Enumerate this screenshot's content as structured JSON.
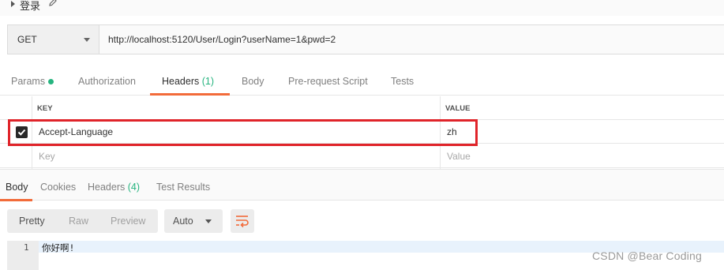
{
  "request": {
    "name": "登录",
    "method": "GET",
    "url": "http://localhost:5120/User/Login?userName=1&pwd=2"
  },
  "request_tabs": [
    {
      "label": "Params",
      "has_dot": true
    },
    {
      "label": "Authorization"
    },
    {
      "label": "Headers",
      "count": "(1)",
      "active": true
    },
    {
      "label": "Body"
    },
    {
      "label": "Pre-request Script"
    },
    {
      "label": "Tests"
    }
  ],
  "headers_table": {
    "key_header": "KEY",
    "value_header": "VALUE",
    "rows": [
      {
        "key": "Accept-Language",
        "value": "zh",
        "checked": true
      }
    ],
    "empty_row": {
      "key_placeholder": "Key",
      "value_placeholder": "Value"
    }
  },
  "response_tabs": [
    {
      "label": "Body",
      "active": true
    },
    {
      "label": "Cookies"
    },
    {
      "label": "Headers",
      "count": "(4)"
    },
    {
      "label": "Test Results"
    }
  ],
  "response_format": {
    "options": [
      "Pretty",
      "Raw",
      "Preview"
    ],
    "selected": "Pretty",
    "language": "Auto"
  },
  "response_body": {
    "lines": [
      {
        "number": "1",
        "text": "你好啊!"
      }
    ]
  },
  "watermark": "CSDN @Bear Coding",
  "colors": {
    "accent": "#f26b3a",
    "success": "#26b47f",
    "highlight_border": "#e0242a"
  },
  "icons": {
    "expand": "caret-right-icon",
    "edit": "pencil-icon",
    "method_dropdown": "chevron-down-icon",
    "checkbox": "check-icon",
    "wrap": "text-wrap-icon"
  }
}
